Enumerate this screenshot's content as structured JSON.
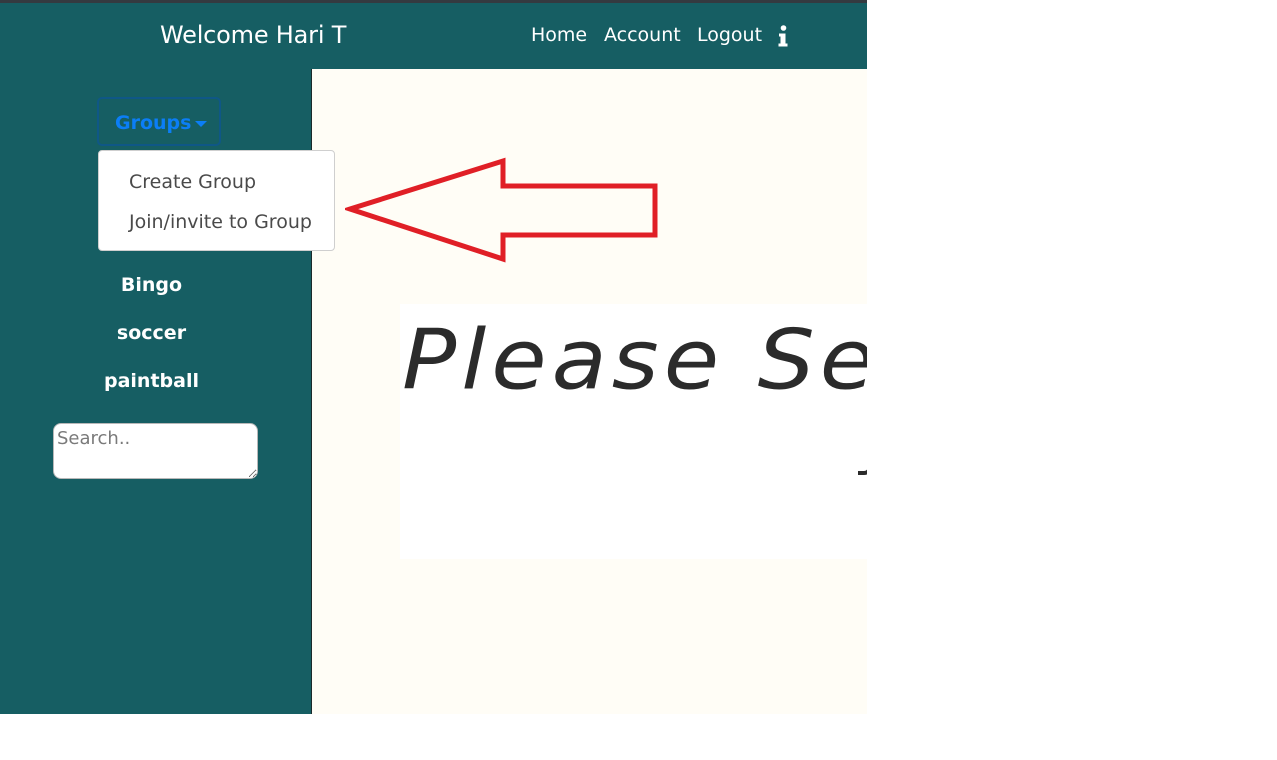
{
  "navbar": {
    "welcome": "Welcome Hari T",
    "links": [
      "Home",
      "Account",
      "Logout"
    ],
    "info_icon": "info-icon"
  },
  "sidebar": {
    "groups_button": "Groups",
    "dropdown": [
      "Create Group",
      "Join/invite to Group"
    ],
    "groups": [
      "Bingo",
      "soccer",
      "paintball"
    ],
    "search_placeholder": "Search.."
  },
  "main": {
    "prompt_text": "Please Sele"
  },
  "annotation": {
    "arrow_color": "#e01f26"
  },
  "colors": {
    "navbar_bg": "#165e63",
    "sidebar_bg": "#165e63",
    "main_bg": "#fffdf6",
    "groups_button_text": "#0b7ef6"
  }
}
